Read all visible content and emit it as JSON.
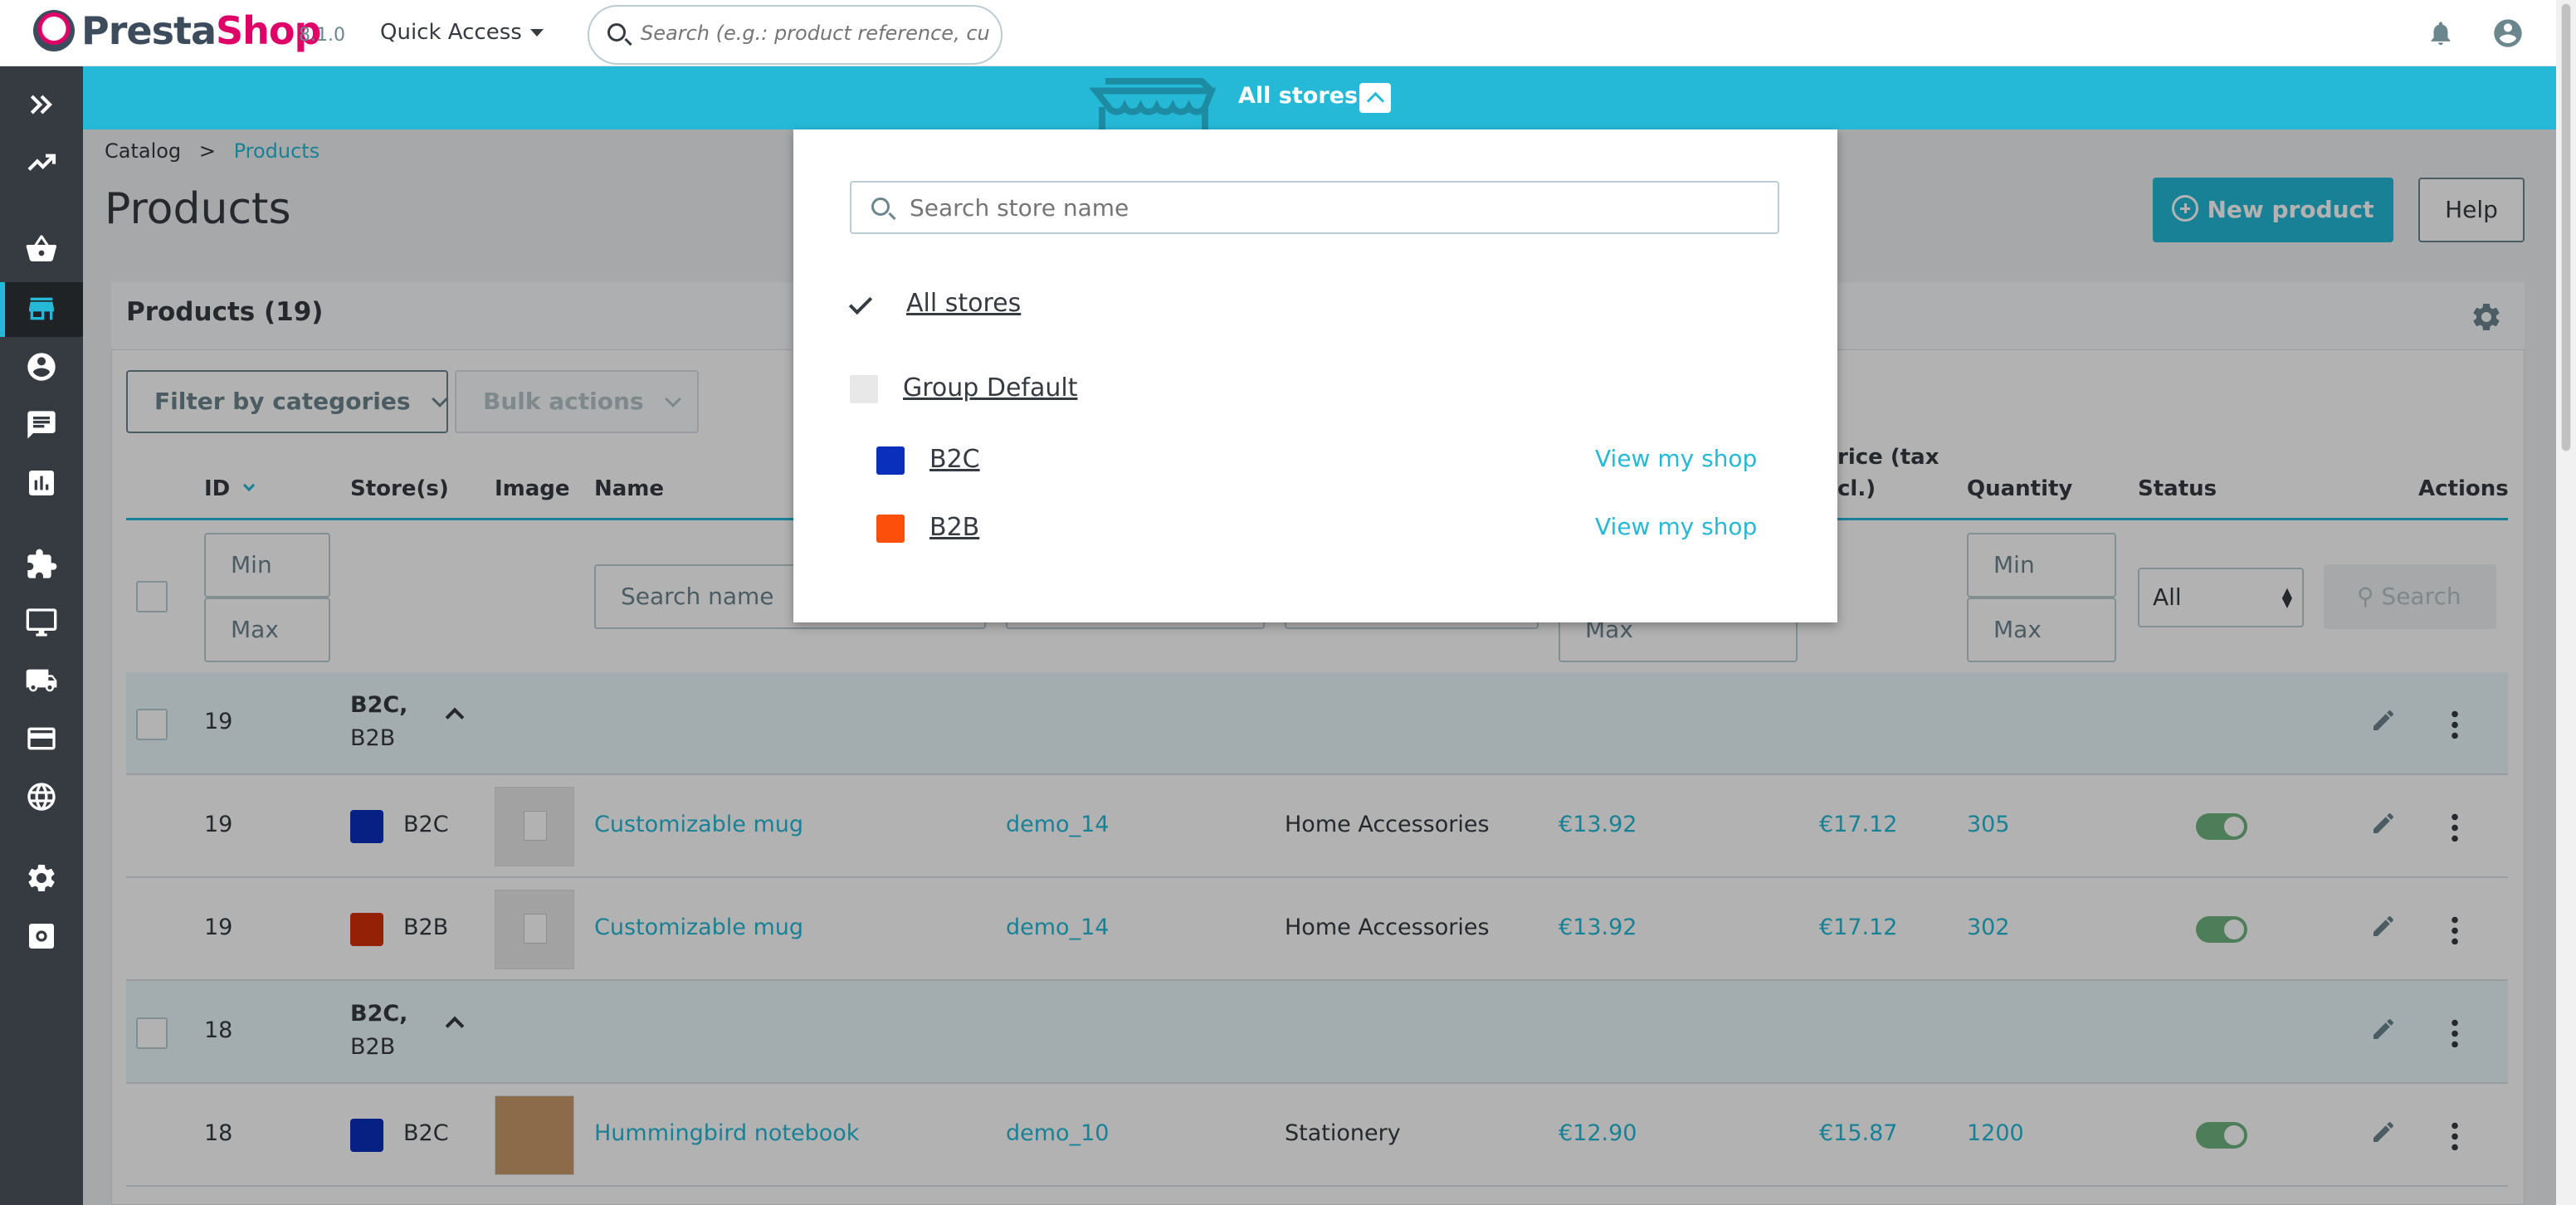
{
  "header": {
    "brand_part1": "Presta",
    "brand_part2": "Shop",
    "version": "8.1.0",
    "quick_access": "Quick Access",
    "search_placeholder": "Search (e.g.: product reference, custon"
  },
  "store_bar": {
    "label": "All stores"
  },
  "breadcrumb": {
    "parent": "Catalog",
    "separator": ">",
    "current": "Products"
  },
  "page": {
    "title": "Products",
    "new_button": "New product",
    "help_button": "Help"
  },
  "card": {
    "title": "Products (19)",
    "filter_button": "Filter by categories",
    "bulk_button": "Bulk actions"
  },
  "table": {
    "headers": {
      "id": "ID",
      "stores": "Store(s)",
      "image": "Image",
      "name": "Name",
      "price_tax_line1": "rice (tax",
      "price_tax_line2": "cl.)",
      "quantity": "Quantity",
      "status": "Status",
      "actions": "Actions"
    },
    "filters": {
      "min": "Min",
      "max": "Max",
      "search_name": "Search name",
      "status_value": "All",
      "search_button": "Search"
    },
    "rows": [
      {
        "type": "group",
        "id": "19",
        "stores_line1": "B2C,",
        "stores_line2": "B2B"
      },
      {
        "type": "product",
        "id": "19",
        "store": "B2C",
        "store_color": "#0a2fbd",
        "name": "Customizable mug",
        "reference": "demo_14",
        "category": "Home Accessories",
        "price": "€13.92",
        "price_tax": "€17.12",
        "quantity": "305"
      },
      {
        "type": "product",
        "id": "19",
        "store": "B2B",
        "store_color": "#d4300a",
        "name": "Customizable mug",
        "reference": "demo_14",
        "category": "Home Accessories",
        "price": "€13.92",
        "price_tax": "€17.12",
        "quantity": "302"
      },
      {
        "type": "group",
        "id": "18",
        "stores_line1": "B2C,",
        "stores_line2": "B2B"
      },
      {
        "type": "product",
        "id": "18",
        "store": "B2C",
        "store_color": "#0a2fbd",
        "name": "Hummingbird notebook",
        "reference": "demo_10",
        "category": "Stationery",
        "price": "€12.90",
        "price_tax": "€15.87",
        "quantity": "1200"
      }
    ]
  },
  "store_dropdown": {
    "search_placeholder": "Search store name",
    "all_stores": "All stores",
    "group_name": "Group Default",
    "shops": [
      {
        "name": "B2C",
        "color": "#0a2fbd",
        "view_link": "View my shop"
      },
      {
        "name": "B2B",
        "color": "#fc4f0c",
        "view_link": "View my shop"
      }
    ]
  },
  "colors": {
    "accent": "#25b9d7",
    "sidebar": "#363a41",
    "status_on": "#70b580"
  }
}
